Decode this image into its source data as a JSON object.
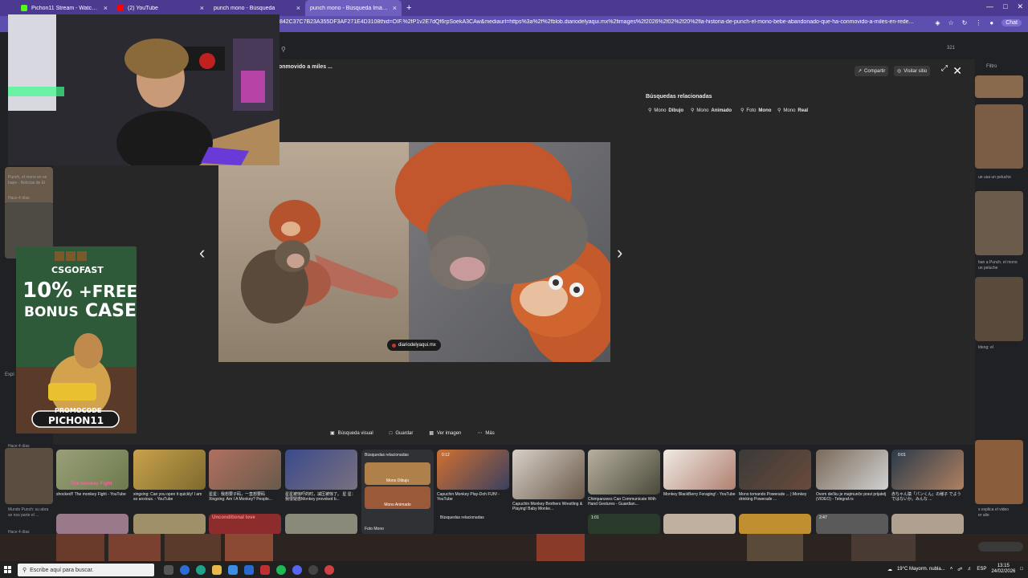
{
  "tabs": [
    {
      "title": "Pichon11 Stream - Watch Liv",
      "favicon_color": "#53fc18"
    },
    {
      "title": "(2) YouTube",
      "favicon_color": "#ff0000"
    },
    {
      "title": "punch mono - Búsqueda",
      "favicon_color": "#6f5fbf"
    },
    {
      "title": "punch mono - Búsqueda Imágene",
      "favicon_color": "#6f5fbf"
    }
  ],
  "address_bar": {
    "url": "842C37C7B23A355DF3AF271E4D3108thid=OIF.%2fP1v2E7dQf6rpSoekA3CAw&mediaurl=https%3a%2f%2fblob.diariodelyaqui.mx%2fimages%2f2026%2f02%2f20%2fla-historia-de-punch-el-mono-bebe-abandonado-que-ha-conmovido-a-miles-en-rede...",
    "chat_label": "Chat"
  },
  "google": {
    "badge_count": "321",
    "filtro_label": "Filtro",
    "left_snippets": [
      "Punch, el mono en se",
      "bape - Noticias de El",
      "Hace 4 días",
      "Hace 4 días",
      "Mundo Punch: su abra",
      "se nos parte el ...",
      "Hace 4 días"
    ],
    "right_snippets": [
      "ue usa un peluche",
      "ban a Punch, el mono",
      "un peluche",
      "ldeog: el",
      "s explica el video",
      "er alie"
    ],
    "expl_label": "Expl"
  },
  "overlay": {
    "title": "onmovido a miles ...",
    "share_label": "Compartir",
    "visit_label": "Visitar sitio",
    "related_title": "Búsquedas relacionadas",
    "chips": [
      {
        "prefix": "Mono ",
        "bold": "Dibujo"
      },
      {
        "prefix": "Mono ",
        "bold": "Animado"
      },
      {
        "prefix": "Foto ",
        "bold": "Mono"
      },
      {
        "prefix": "Mono ",
        "bold": "Real"
      }
    ],
    "source_label": "diariodelyaqui.mx",
    "actions": [
      "Búsqueda visual",
      "Guardar",
      "Ver imagen",
      "Más"
    ]
  },
  "thumbnails": [
    {
      "caption": "shocked!! The monkey Fight - YouTube",
      "overlay": "The monkey Fight"
    },
    {
      "caption": "xingxing: Can you open it quickly! I am so anxious. - YouTube",
      "overlay": ""
    },
    {
      "caption": "星星：我想要子码，一直想要码 Xingxing: Am I A Monkey? People...",
      "overlay": ""
    },
    {
      "caption": "星星被惊吓的时，减压被惊了。 星 星：我很疑惑Monkey provoked b...",
      "overlay": ""
    },
    {
      "caption": "Capuchin Monkey Play-Doh FUN! - YouTube",
      "overlay": "0:12"
    },
    {
      "caption": "Capuchin Monkey Brothers Wrestling & Playing! Baby Monke...",
      "overlay": ""
    },
    {
      "caption": "Chimpanzees Can Communicate With Hand Gestures - Guardian...",
      "overlay": ""
    },
    {
      "caption": "Monkey BlackBerry Foraging! - YouTube",
      "overlay": ""
    },
    {
      "caption": "Mono tomando Powerade ... | Monkey drinking Powerade ...",
      "overlay": ""
    },
    {
      "caption": "Ovom dečku je majmunče pravi prijatelj (VIDEO) - Telegraf.rs",
      "overlay": ""
    },
    {
      "caption": "赤ちゃん猿「パンくん」の様子 でようではないか。みんな ...",
      "overlay": "0:01"
    }
  ],
  "related_mini": {
    "title": "Búsquedas relacionadas",
    "items": [
      "Mono Dibujo",
      "Mono Animado",
      "Foto Mono"
    ],
    "bottom_title": "Búsquedas relacionadas"
  },
  "second_row_overlays": [
    "Unconditional love",
    "1:01",
    "2:47"
  ],
  "taskbar": {
    "search_placeholder": "Escribe aquí para buscar.",
    "weather": "19°C  Mayorm. nubla...",
    "lang": "ESP",
    "time": "13:15",
    "date": "24/02/2026"
  },
  "ad": {
    "brand": "CSGOFAST",
    "bonus_pct": "10%",
    "bonus_word": "BONUS",
    "free_case_1": "+FREE",
    "free_case_2": "CASE",
    "promo_label": "PROMOCODE",
    "promo_code": "PICHON11"
  },
  "colors": {
    "tabbar": "#4b3a8f",
    "address": "#5d4fb0",
    "overlay_bg": "#272727",
    "page_bg": "#202124"
  }
}
